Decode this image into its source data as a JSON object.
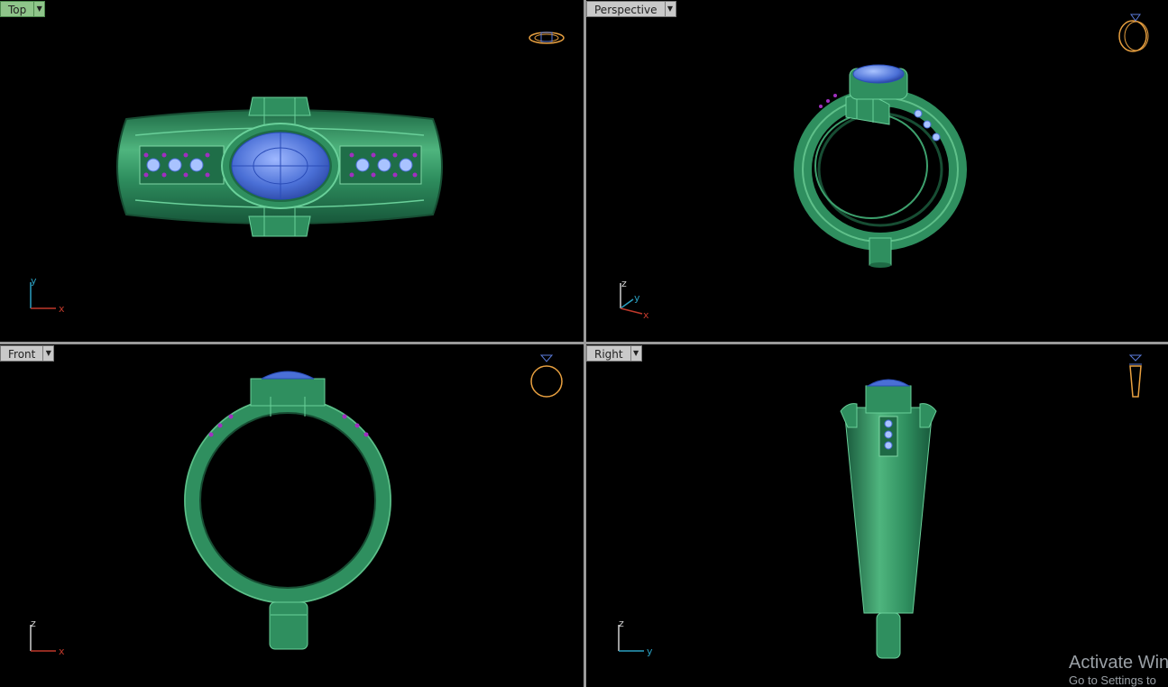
{
  "viewports": {
    "top": {
      "label": "Top",
      "axis_h": "x",
      "axis_v": "y"
    },
    "perspective": {
      "label": "Perspective",
      "axis_1": "x",
      "axis_2": "y",
      "axis_3": "z"
    },
    "front": {
      "label": "Front",
      "axis_h": "x",
      "axis_v": "z"
    },
    "right": {
      "label": "Right",
      "axis_h": "y",
      "axis_v": "z"
    }
  },
  "watermark": {
    "line1": "Activate Win",
    "line2": "Go to Settings to"
  },
  "colors": {
    "background": "#000000",
    "ring_metal": "#2f8f5f",
    "ring_highlight": "#5fc08a",
    "gem_blue": "#4a6fd6",
    "accent_purple": "#a02fc0",
    "active_tab": "#8fc58a",
    "nav_orange": "#e8a040",
    "axis_x": "#c0392b",
    "axis_y": "#2a9fc0",
    "axis_z": "#d0d0d0"
  },
  "icons": [
    "dropdown-arrow-icon",
    "ring-navigation-icon",
    "axis-indicator-icon"
  ]
}
